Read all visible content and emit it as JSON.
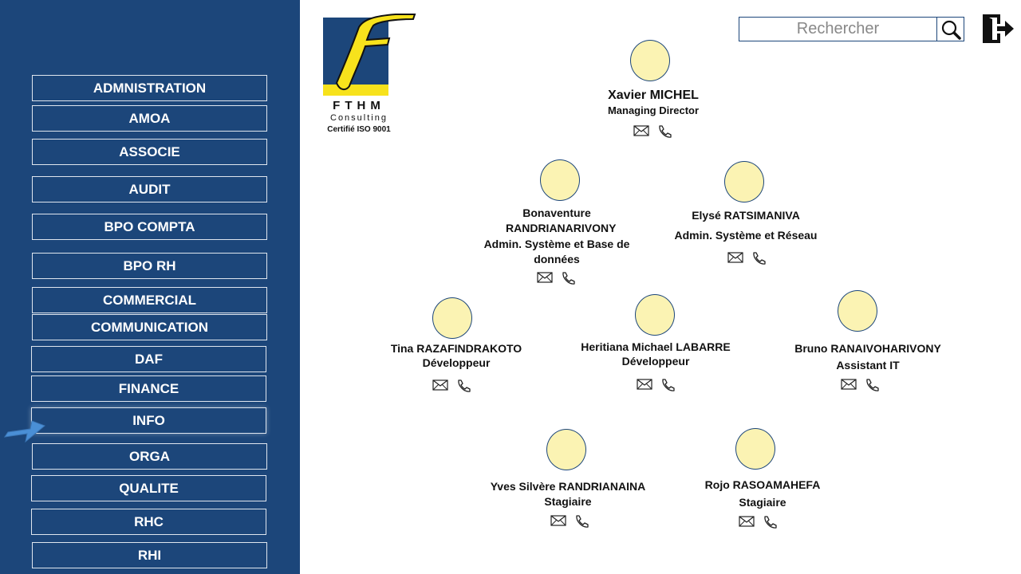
{
  "sidebar": {
    "departments": [
      {
        "label": "ADMNISTRATION"
      },
      {
        "label": "AMOA"
      },
      {
        "label": "ASSOCIE"
      },
      {
        "label": "AUDIT"
      },
      {
        "label": "BPO COMPTA"
      },
      {
        "label": "BPO RH"
      },
      {
        "label": "COMMERCIAL"
      },
      {
        "label": "COMMUNICATION"
      },
      {
        "label": "DAF"
      },
      {
        "label": "FINANCE"
      },
      {
        "label": "INFO"
      },
      {
        "label": "ORGA"
      },
      {
        "label": "QUALITE"
      },
      {
        "label": "RHC"
      },
      {
        "label": "RHI"
      }
    ],
    "selected": "INFO"
  },
  "logo": {
    "brand": "FTHM",
    "subtitle": "Consulting",
    "certification": "Certifié ISO 9001"
  },
  "search": {
    "placeholder": "Rechercher",
    "icon": "search-icon"
  },
  "logout": {
    "icon": "logout-icon"
  },
  "org": {
    "people": [
      {
        "name": "Xavier MICHEL",
        "role": "Managing Director"
      },
      {
        "name": "Bonaventure RANDRIANARIVONY",
        "role": "Admin. Système et Base de données"
      },
      {
        "name": "Elysé RATSIMANIVA",
        "role": "Admin. Système et Réseau"
      },
      {
        "name": "Tina RAZAFINDRAKOTO",
        "role": "Développeur"
      },
      {
        "name": "Heritiana Michael LABARRE",
        "role": "Développeur"
      },
      {
        "name": "Bruno RANAIVOHARIVONY",
        "role": "Assistant IT"
      },
      {
        "name": "Yves Silvère RANDRIANAINA",
        "role": "Stagiaire"
      },
      {
        "name": "Rojo RASOAMAHEFA",
        "role": "Stagiaire"
      }
    ],
    "icons": {
      "mail": "mail-icon",
      "phone": "phone-icon"
    }
  },
  "colors": {
    "sidebar": "#1c467a",
    "avatar_fill": "#fbf3b3",
    "logo_yellow": "#f7e21c",
    "logo_blue": "#1c467a"
  }
}
